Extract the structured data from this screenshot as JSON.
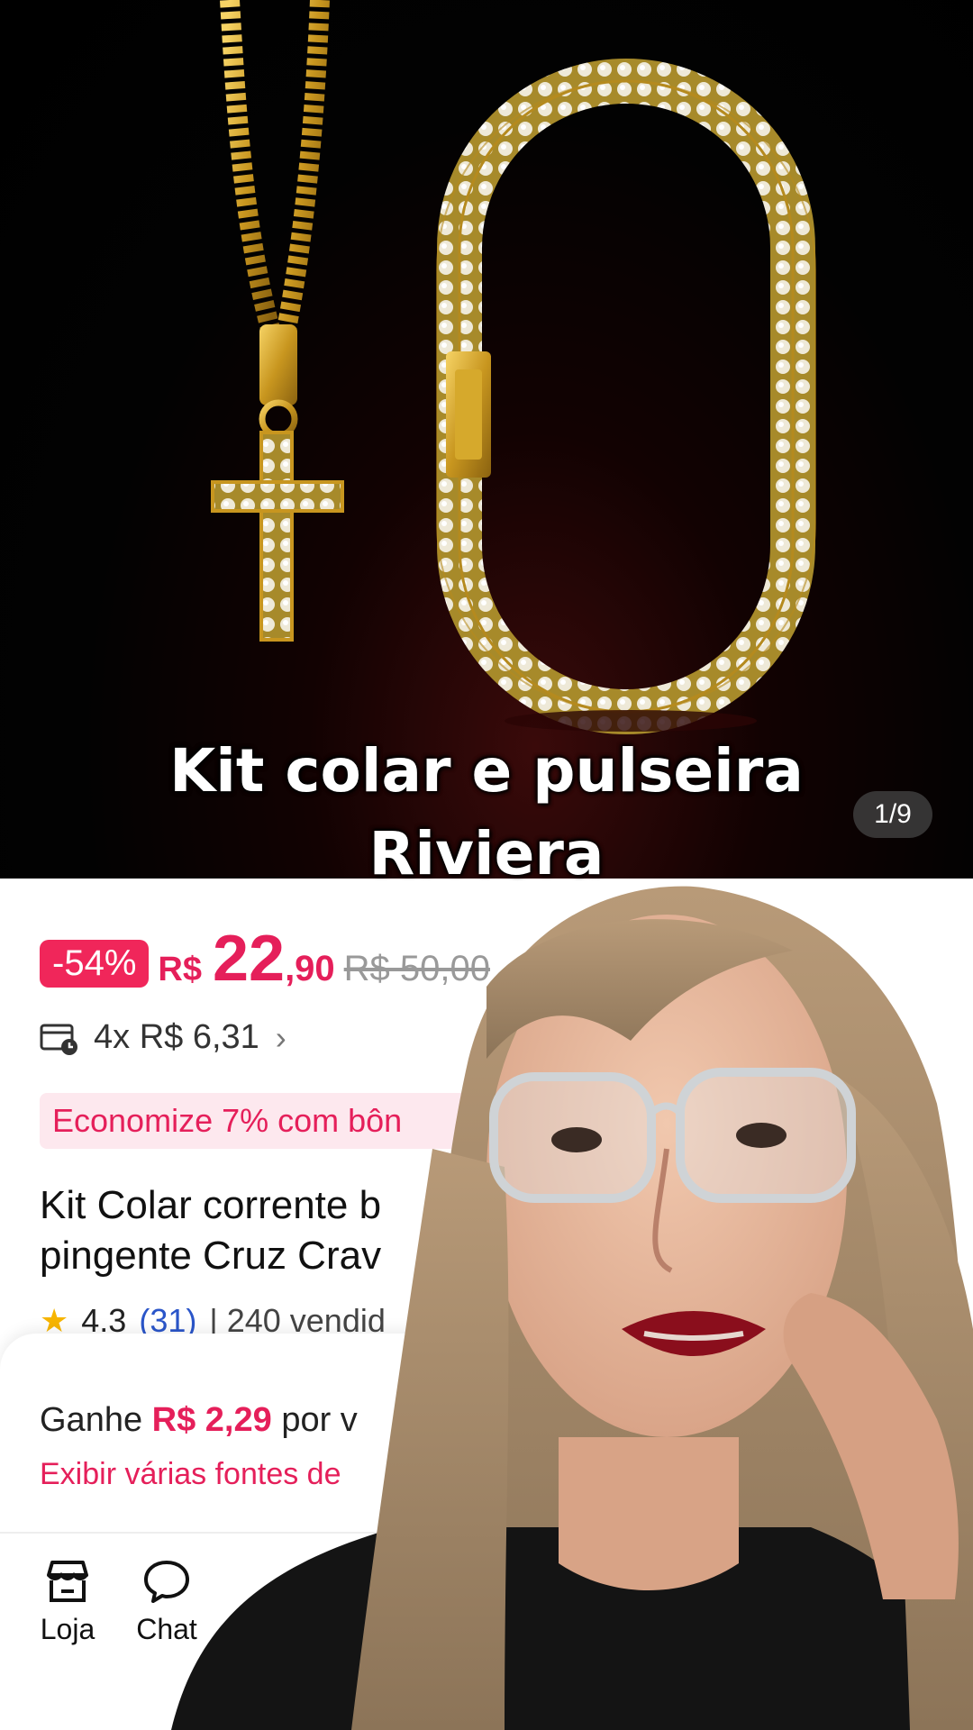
{
  "carousel": {
    "caption_line1": "Kit colar e pulseira",
    "caption_line2": "Riviera",
    "counter": "1/9"
  },
  "price": {
    "discount": "-54%",
    "currency": "R$",
    "integer": "22",
    "decimal": ",90",
    "original": "R$ 50,00"
  },
  "installments": {
    "text": "4x R$ 6,31"
  },
  "bonus": {
    "text": "Economize 7% com bôn"
  },
  "product": {
    "title_line1": "Kit Colar corrente b",
    "title_line2": "pingente Cruz Crav"
  },
  "rating": {
    "score": "4.3",
    "count": "(31)",
    "sold": "| 240 vendid"
  },
  "earn": {
    "prefix": "Ganhe",
    "amount": "R$ 2,29",
    "suffix": "por v",
    "sources_link": "Exibir várias fontes de"
  },
  "bottom_nav": [
    {
      "label": "Loja",
      "icon": "store-icon"
    },
    {
      "label": "Chat",
      "icon": "chat-icon"
    }
  ],
  "colors": {
    "accent": "#e51f5a",
    "discount_bg": "#f0265a",
    "link": "#2a55c9",
    "star": "#f7b500"
  }
}
